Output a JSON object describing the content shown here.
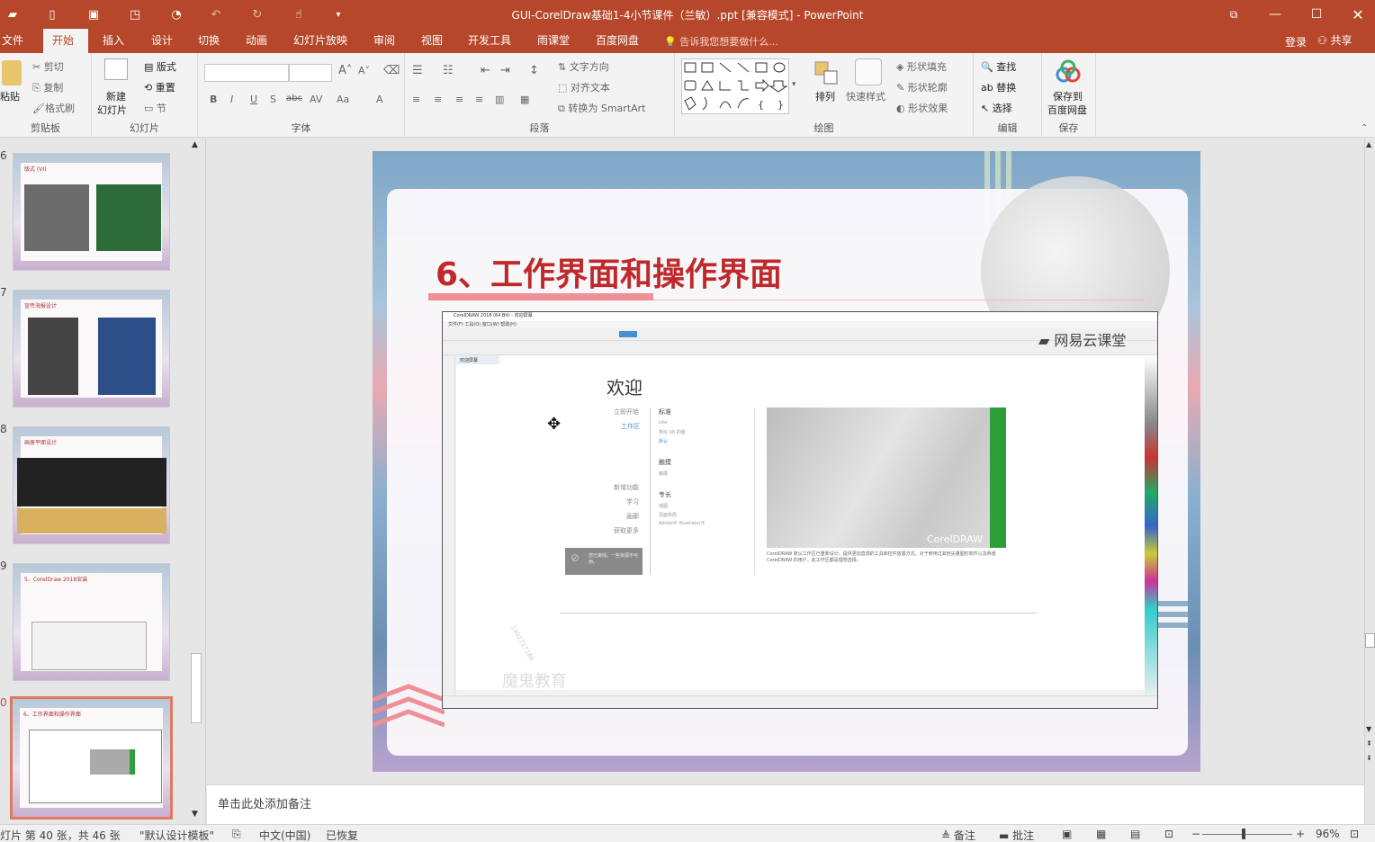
{
  "window": {
    "title": "GUI-CorelDraw基础1-4小节课件（兰敏）.ppt [兼容模式] - PowerPoint"
  },
  "quick_access": [
    "open-icon",
    "new-icon",
    "save-icon",
    "print-preview-icon",
    "slideshow-icon",
    "undo-icon",
    "redo-icon",
    "touch-mode-icon",
    "customize-icon"
  ],
  "tabs": [
    "文件",
    "开始",
    "插入",
    "设计",
    "切换",
    "动画",
    "幻灯片放映",
    "审阅",
    "视图",
    "开发工具",
    "雨课堂",
    "百度网盘"
  ],
  "active_tab": "开始",
  "tell_me": "告诉我您想要做什么...",
  "account": {
    "login": "登录",
    "share": "共享"
  },
  "ribbon": {
    "clipboard": {
      "label": "剪贴板",
      "paste": "粘贴",
      "cut": "剪切",
      "copy": "复制",
      "format_painter": "格式刷"
    },
    "slides": {
      "label": "幻灯片",
      "new_slide": "新建\n幻灯片",
      "new_slide_line1": "新建",
      "new_slide_line2": "幻灯片",
      "layout": "版式",
      "reset": "重置",
      "section": "节"
    },
    "font": {
      "label": "字体"
    },
    "paragraph": {
      "label": "段落",
      "text_direction": "文字方向",
      "align_text": "对齐文本",
      "convert_smartart": "转换为 SmartArt"
    },
    "drawing": {
      "label": "绘图",
      "arrange": "排列",
      "quick_styles": "快速样式",
      "shape_fill": "形状填充",
      "shape_outline": "形状轮廓",
      "shape_effects": "形状效果"
    },
    "editing": {
      "label": "编辑",
      "find": "查找",
      "replace": "替换",
      "select": "选择"
    },
    "save": {
      "label": "保存",
      "save_to": "保存到",
      "baidu": "百度网盘"
    }
  },
  "thumbnails": [
    {
      "number": "6",
      "title": "版式 (VI)"
    },
    {
      "number": "7",
      "title": "宣传海报设计"
    },
    {
      "number": "8",
      "title": "画册平面设计"
    },
    {
      "number": "9",
      "title": "5、CorelDraw 2018安装"
    },
    {
      "number": "0",
      "title": "6、工作界面和操作界面",
      "active": true
    }
  ],
  "slide": {
    "title": "6、工作界面和操作界面",
    "embedded": {
      "app_title": "CorelDRAW 2018 (64 Bit) - 欢迎屏幕",
      "menu": "文件(F)   工具(O)   窗口(W)   帮助(H)",
      "doc_tab": "欢迎屏幕",
      "logo": "网易云课堂",
      "welcome": "欢迎",
      "left_links": [
        "立即开始",
        "工作区",
        "新增功能",
        "学习",
        "画廊",
        "获取更多"
      ],
      "sections": [
        {
          "name": "标准",
          "items": [
            "Lite",
            "类似 X6 的版",
            "默认"
          ]
        },
        {
          "name": "触摸",
          "items": [
            "触摸"
          ]
        },
        {
          "name": "专长",
          "items": [
            "插图",
            "页面布局",
            "Adobe® Illustrator®"
          ]
        }
      ],
      "image_caption": "CorelDRAW",
      "description": "CorelDRAW 默认工作区已重新设计，提供更加直观的工具和控件放置方式。对于使用过其他矢量图形软件以及熟悉 CorelDRAW 的用户，此工作区都是理想选择。",
      "signin_box": "您已离线。一些资源不可用。",
      "watermark": "魔鬼教育",
      "watermark_id": "1402717186"
    }
  },
  "notes_placeholder": "单击此处添加备注",
  "status": {
    "slide_info": "灯片 第 40 张，共 46 张",
    "theme": "\"默认设计模板\"",
    "language": "中文(中国)",
    "recovered": "已恢复",
    "notes": "备注",
    "comments": "批注",
    "zoom": "96%",
    "zoom_level": 0.46
  },
  "colors": {
    "accent": "#b7472a",
    "title_red": "#c0292b"
  }
}
